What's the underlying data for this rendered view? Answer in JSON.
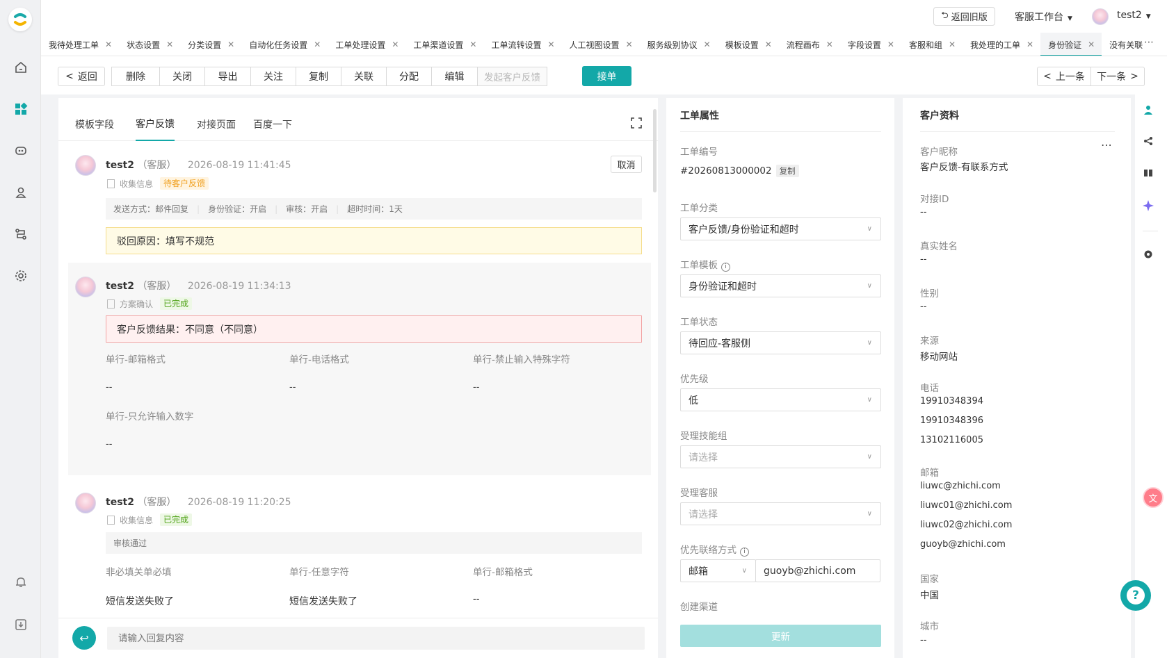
{
  "app": {
    "title": "客服工作台",
    "accent": "#13a8a8",
    "user_name": "test2",
    "back_old": "返回旧版"
  },
  "tabs": [
    {
      "label": "我待处理工单"
    },
    {
      "label": "状态设置"
    },
    {
      "label": "分类设置"
    },
    {
      "label": "自动化任务设置"
    },
    {
      "label": "工单处理设置"
    },
    {
      "label": "工单渠道设置"
    },
    {
      "label": "工单流转设置"
    },
    {
      "label": "人工视图设置"
    },
    {
      "label": "服务级别协议"
    },
    {
      "label": "模板设置"
    },
    {
      "label": "流程画布"
    },
    {
      "label": "字段设置"
    },
    {
      "label": "客服和组"
    },
    {
      "label": "我处理的工单"
    },
    {
      "label": "身份验证",
      "active": true
    },
    {
      "label": "没有关联"
    }
  ],
  "toolbar": {
    "back": "返回",
    "actions": [
      "删除",
      "关闭",
      "导出",
      "关注",
      "复制",
      "关联",
      "分配",
      "编辑"
    ],
    "disabled_action": "发起客户反馈",
    "accept": "接单",
    "prev": "上一条",
    "next": "下一条"
  },
  "content_tabs": [
    "模板字段",
    "客户反馈",
    "对接页面",
    "百度一下"
  ],
  "feedback": [
    {
      "user": "test2",
      "role": "（客服）",
      "time": "2026-08-19 11:41:45",
      "type": "收集信息",
      "status": "待客户反馈",
      "cancel": "取消",
      "info": [
        "发送方式：邮件回复",
        "身份验证：开启",
        "审核：开启",
        "超时时间：1天"
      ],
      "reason": "驳回原因：填写不规范"
    },
    {
      "user": "test2",
      "role": "（客服）",
      "time": "2026-08-19 11:34:13",
      "type": "方案确认",
      "status": "已完成",
      "result": "客户反馈结果：不同意（不同意）",
      "fields": [
        {
          "label": "单行-邮箱格式",
          "value": "--"
        },
        {
          "label": "单行-电话格式",
          "value": "--"
        },
        {
          "label": "单行-禁止输入特殊字符",
          "value": "--"
        },
        {
          "label": "单行-只允许输入数字",
          "value": "--"
        }
      ]
    },
    {
      "user": "test2",
      "role": "（客服）",
      "time": "2026-08-19 11:20:25",
      "type": "收集信息",
      "status": "已完成",
      "note": "审核通过",
      "fields": [
        {
          "label": "非必填关单必填",
          "value": "短信发送失败了"
        },
        {
          "label": "单行-任意字符",
          "value": "短信发送失败了"
        },
        {
          "label": "单行-邮箱格式",
          "value": "--"
        }
      ]
    }
  ],
  "reply": {
    "placeholder": "请输入回复内容"
  },
  "properties": {
    "title": "工单属性",
    "number_label": "工单编号",
    "number": "#20260813000002",
    "copy": "复制",
    "category_label": "工单分类",
    "category": "客户反馈/身份验证和超时",
    "template_label": "工单模板",
    "template": "身份验证和超时",
    "status_label": "工单状态",
    "status": "待回应-客服侧",
    "priority_label": "优先级",
    "priority": "低",
    "skill_label": "受理技能组",
    "skill_placeholder": "请选择",
    "agent_label": "受理客服",
    "agent_placeholder": "请选择",
    "contact_label": "优先联络方式",
    "contact_type": "邮箱",
    "contact_value": "guoyb@zhichi.com",
    "channel_label": "创建渠道",
    "update": "更新"
  },
  "customer": {
    "title": "客户资料",
    "nick_label": "客户昵称",
    "nick": "客户反馈-有联系方式",
    "dock_label": "对接ID",
    "dock": "--",
    "realname_label": "真实姓名",
    "realname": "--",
    "gender_label": "性别",
    "gender": "--",
    "source_label": "来源",
    "source": "移动网站",
    "phone_label": "电话",
    "phones": [
      "19910348394",
      "19910348396",
      "13102116005"
    ],
    "email_label": "邮箱",
    "emails": [
      "liuwc@zhichi.com",
      "liuwc01@zhichi.com",
      "liuwc02@zhichi.com",
      "guoyb@zhichi.com"
    ],
    "country_label": "国家",
    "country": "中国",
    "city_label": "城市",
    "city": "--"
  }
}
